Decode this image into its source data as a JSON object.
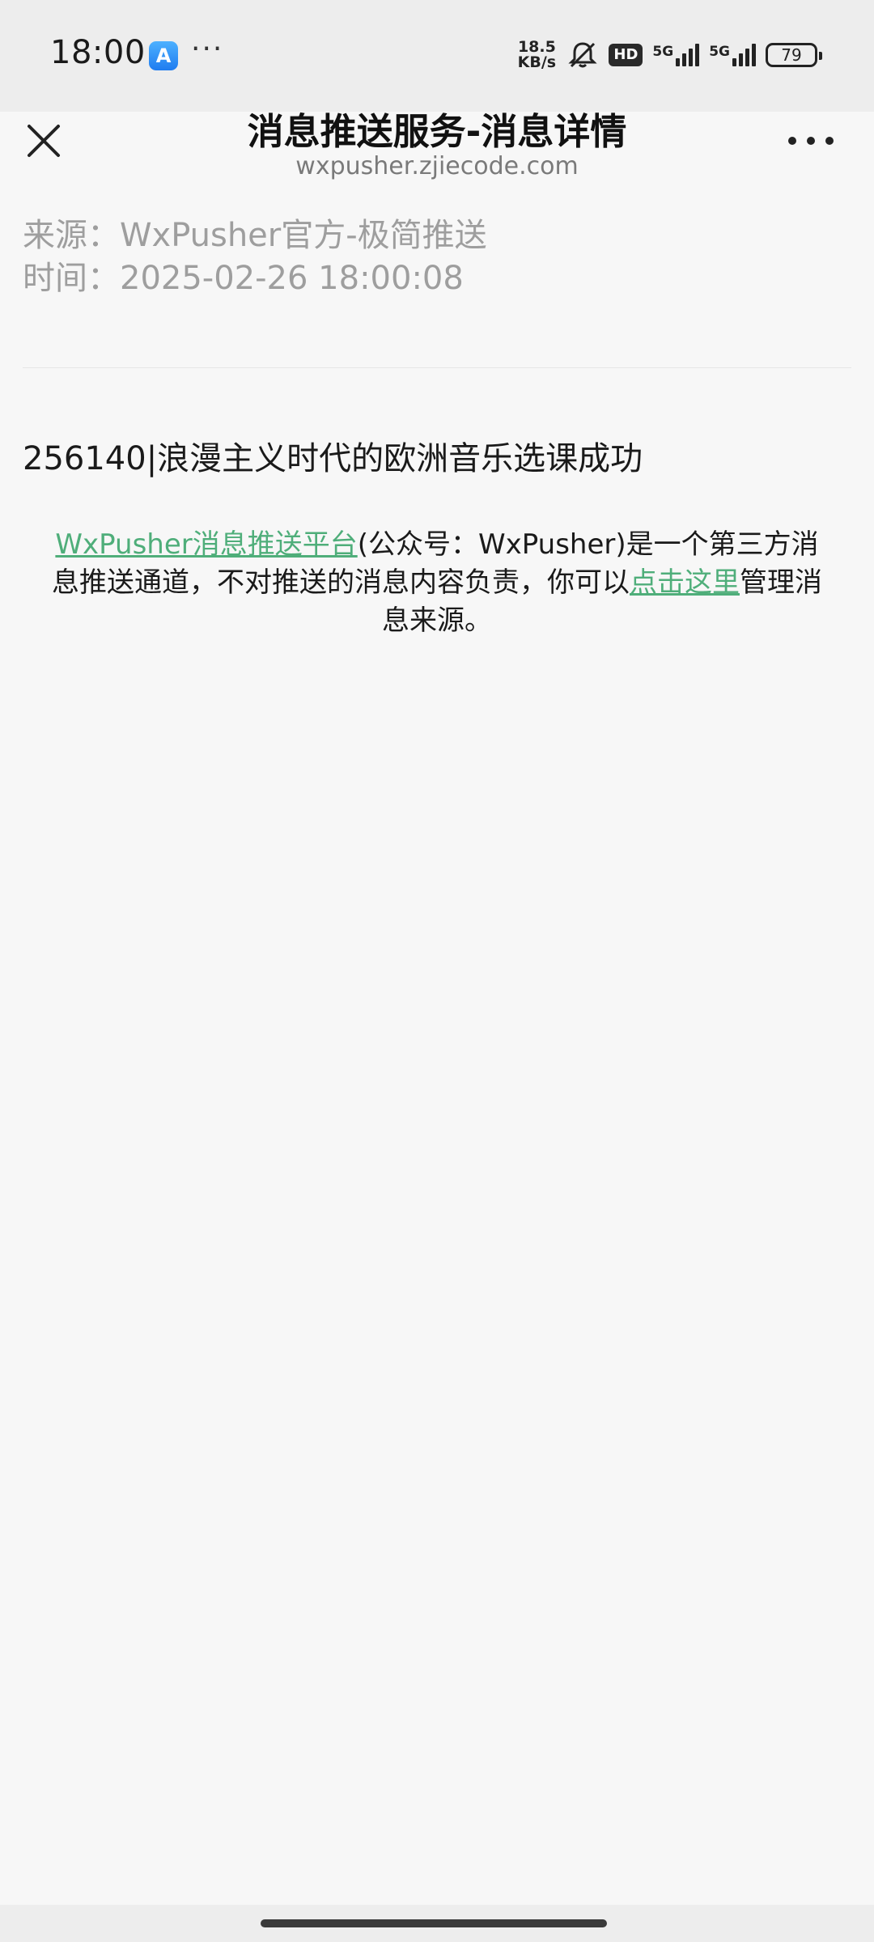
{
  "status_bar": {
    "time": "18:00",
    "more": "···",
    "net_speed_value": "18.5",
    "net_speed_unit": "KB/s",
    "hd": "HD",
    "signal_1": "5G",
    "signal_2": "5G",
    "battery": "79",
    "icons": [
      "app-store-icon",
      "bell-muted-icon",
      "signal-icon",
      "battery-icon"
    ]
  },
  "nav": {
    "title": "消息推送服务-消息详情",
    "subtitle": "wxpusher.zjiecode.com",
    "close_icon": "close-icon",
    "more_icon": "more-icon"
  },
  "meta": {
    "source": "来源：WxPusher官方-极简推送",
    "time": "时间：2025-02-26 18:00:08"
  },
  "message": {
    "title": "256140|浪漫主义时代的欧洲音乐选课成功"
  },
  "disclaimer": {
    "link_platform": "WxPusher消息推送平台",
    "text_1": "(公众号：WxPusher)是一个第三方消息推送通道，不对推送的消息内容负责，你可以",
    "link_manage": "点击这里",
    "text_2": "管理消息来源。"
  },
  "colors": {
    "link": "#4fae7a",
    "meta": "#9e9e9e",
    "background": "#f7f7f7",
    "header": "#ededed"
  }
}
